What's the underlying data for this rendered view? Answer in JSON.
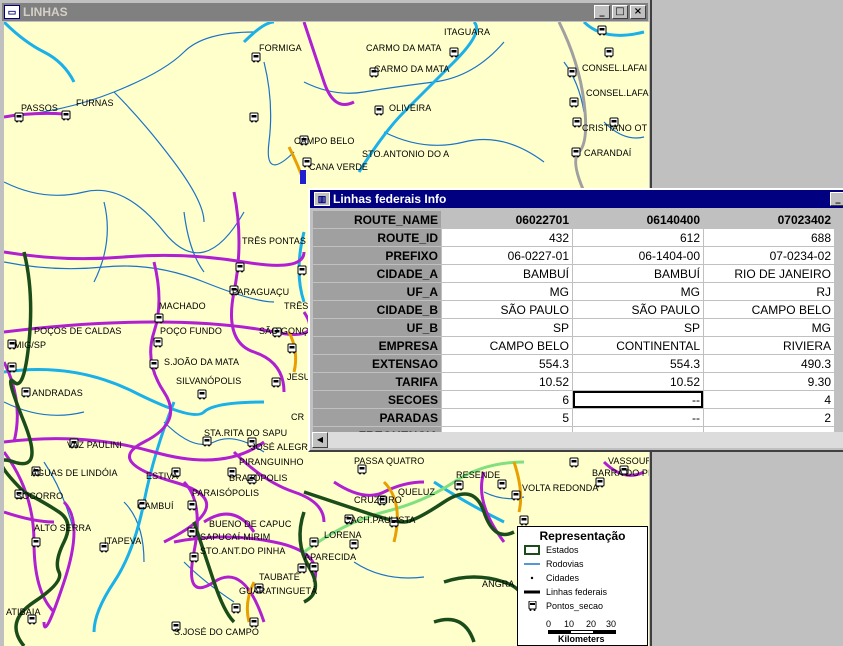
{
  "map_window": {
    "title": "LINHAS",
    "icons": {
      "system": "map-window-icon",
      "minimize": "minimize-icon",
      "maximize": "maximize-icon",
      "close": "close-icon"
    }
  },
  "cities": [
    "ITAGUARA",
    "FORMIGA",
    "CARMO DA MATA",
    "CARMO DA MATA",
    "CONSEL.LAFAI",
    "CONSEL.LAFAI",
    "PASSOS",
    "FURNAS",
    "OLIVEIRA",
    "CRISTIANO OT",
    "CAMPO BELO",
    "STO.ANTONIO DO A",
    "CARANDAÍ",
    "CANA VERDE",
    "TRÊS PONTAS",
    "PARAGUAÇU",
    "MACHADO",
    "TRÊS",
    "POÇOS DE CALDAS",
    "POÇO FUNDO",
    "SÃO GONÇ",
    "MIG/SP",
    "S.JOÃO DA MATA",
    "JESU",
    "SILVANÓPOLIS",
    "ANDRADAS",
    "CR",
    "STA.RITA DO SAPU",
    "JOSÉ ALEGR",
    "PIRANGUINHO",
    "VAZ PAULINI",
    "ÁGUAS DE LINDÓIA",
    "ESTIVA",
    "BRAZÓPOLIS",
    "PARAISÓPOLIS",
    "PASSA QUATRO",
    "RESENDE",
    "VASSOUR",
    "BARRA DO PIRA",
    "VOLTA REDONDA",
    "SOCORRO",
    "CAMBUÍ",
    "CRUZEIRO",
    "QUELUZ",
    "CACH.PAULISTA",
    "LORENA",
    "ALTO SERRA",
    "ITAPEVA",
    "BUENO DE CAPUC",
    "SAPUCAÍ-MIRIM",
    "STO.ANT.DO PINHA",
    "APARECIDA",
    "TAUBATÉ",
    "GUARATINGUETÁ",
    "ATIBAIA",
    "S.JOSÉ DO CAMPO",
    "ANGRA"
  ],
  "info_window": {
    "title": "Linhas federais Info",
    "columns": [
      "06022701",
      "06140400",
      "07023402"
    ],
    "rows": [
      {
        "field": "ROUTE_ID",
        "values": [
          "432",
          "612",
          "688"
        ]
      },
      {
        "field": "PREFIXO",
        "values": [
          "06-0227-01",
          "06-1404-00",
          "07-0234-02"
        ]
      },
      {
        "field": "CIDADE_A",
        "values": [
          "BAMBUÍ",
          "BAMBUÍ",
          "RIO DE JANEIRO"
        ]
      },
      {
        "field": "UF_A",
        "values": [
          "MG",
          "MG",
          "RJ"
        ]
      },
      {
        "field": "CIDADE_B",
        "values": [
          "SÃO PAULO",
          "SÃO PAULO",
          "CAMPO BELO"
        ]
      },
      {
        "field": "UF_B",
        "values": [
          "SP",
          "SP",
          "MG"
        ]
      },
      {
        "field": "EMPRESA",
        "values": [
          "CAMPO BELO",
          "CONTINENTAL",
          "RIVIERA"
        ]
      },
      {
        "field": "EXTENSAO",
        "values": [
          "554.3",
          "554.3",
          "490.3"
        ]
      },
      {
        "field": "TARIFA",
        "values": [
          "10.52",
          "10.52",
          "9.30"
        ]
      },
      {
        "field": "SECOES",
        "values": [
          "6",
          "--",
          "4"
        ]
      },
      {
        "field": "PARADAS",
        "values": [
          "5",
          "--",
          "2"
        ]
      },
      {
        "field": "FREQUENCIA",
        "values": [
          "",
          "",
          ""
        ]
      }
    ],
    "header_field": "ROUTE_NAME"
  },
  "legend": {
    "title": "Representação",
    "items": [
      {
        "label": "Estados",
        "symbol": "state-border",
        "color": "#1a4d1a"
      },
      {
        "label": "Rodovias",
        "symbol": "line",
        "color": "#1a73c8"
      },
      {
        "label": "Cidades",
        "symbol": "dot",
        "color": "#000000"
      },
      {
        "label": "Linhas federais",
        "symbol": "thick-line",
        "color": "#000000"
      },
      {
        "label": "Pontos_secao",
        "symbol": "bus-icon",
        "color": "#000000"
      }
    ],
    "scale": {
      "ticks": [
        "0",
        "10",
        "20",
        "30"
      ],
      "unit": "Kilometers"
    }
  },
  "colors": {
    "map_background": "#ffffcc",
    "rivers": "#1a73c8",
    "federal_routes": "#b020d0",
    "highways": "#1ab0e8",
    "states": "#1a4d1a",
    "selected_route": "#e8a000",
    "other_route": "#a0a0a0",
    "green_route": "#80e080"
  }
}
